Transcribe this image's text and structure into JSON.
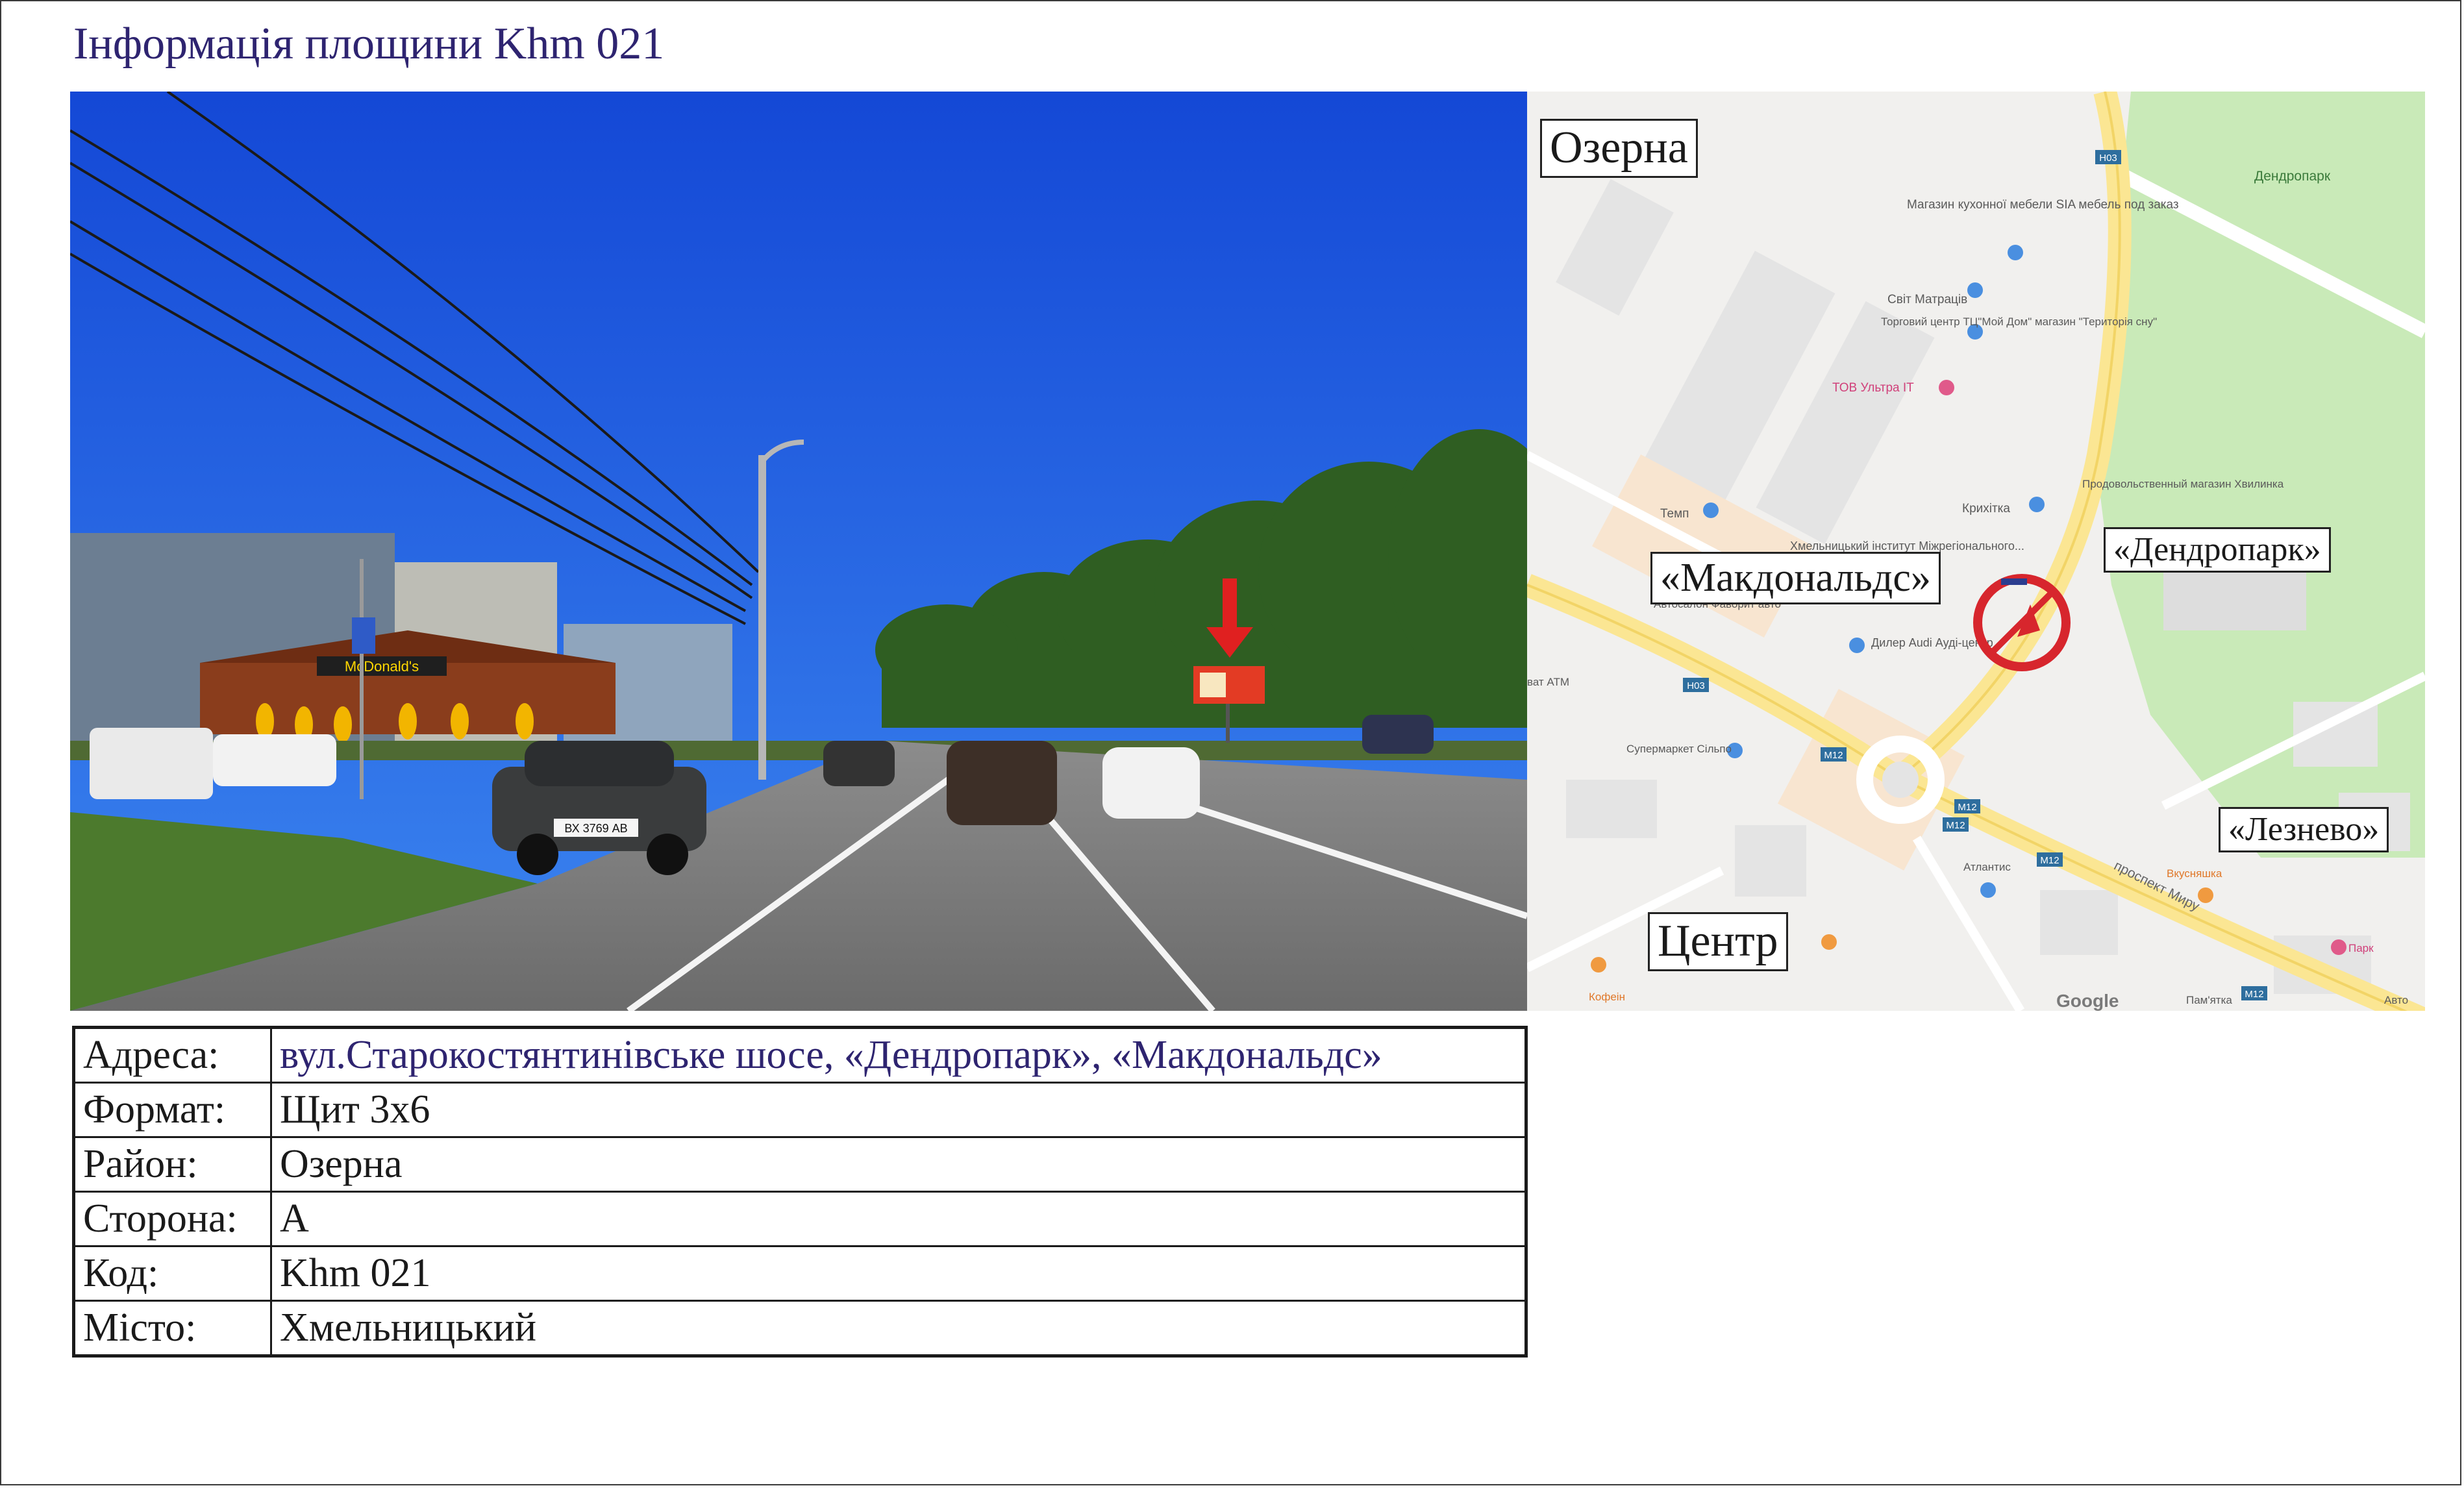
{
  "title": "Інформація площини Khm 021",
  "photo": {
    "description_icon": "street-photo",
    "overlay_arrow_color": "#e02020",
    "storefront_sign": "McDonald's",
    "plate_left": "ВХ 3769 АВ"
  },
  "map": {
    "labels": {
      "ozerna": "Озерна",
      "makdonalds": "«Макдональдс»",
      "dendropark": "«Дендропарк»",
      "leznevo": "«Лезнево»",
      "tsentr": "Центр"
    },
    "poi": [
      "Дендропарк",
      "Магазин кухонної мебели SIA мебель под заказ",
      "Світ Матраців",
      "Торговий центр ТЦ\"Мой Дом\" магазин \"Територія сну\"",
      "ТОВ Ультра IT",
      "Темп",
      "Крихітка",
      "Продовольственный магазин Хвилинка",
      "Хмельницький інститут Міжрегіонального...",
      "Автосалон Фаворит авто",
      "Дилер Audi Ауді-центр",
      "ват ATM",
      "Супермаркет Сільпо",
      "Атлантис",
      "Вкусняшка",
      "Кофеін",
      "Парк",
      "Пам'ятка",
      "Авто",
      "проспект Миру",
      "Google"
    ],
    "road_badges": [
      "H03",
      "H03",
      "M12",
      "M12",
      "M12",
      "M12",
      "M12"
    ],
    "marker_color": "#d7262d"
  },
  "info": {
    "rows": [
      {
        "label": "Адреса:",
        "value": "вул.Старокостянтинівське шосе, «Дендропарк», «Макдональдс»"
      },
      {
        "label": "Формат:",
        "value": "Щит 3х6"
      },
      {
        "label": "Район:",
        "value": "Озерна"
      },
      {
        "label": "Сторона:",
        "value": "А"
      },
      {
        "label": "Код:",
        "value": "Khm 021"
      },
      {
        "label": "Місто:",
        "value": "Хмельницький"
      }
    ]
  }
}
